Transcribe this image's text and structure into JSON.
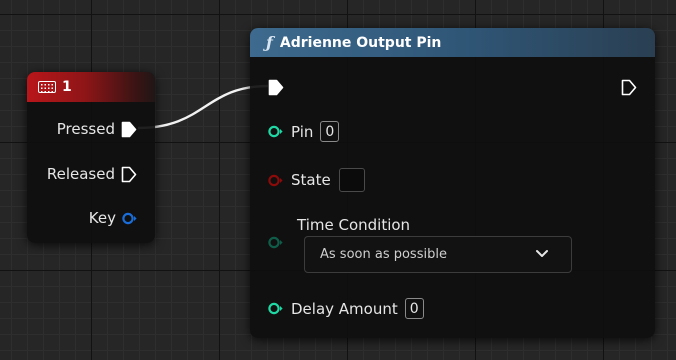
{
  "input_key_node": {
    "title": "1",
    "pins": {
      "pressed": "Pressed",
      "released": "Released",
      "key": "Key"
    }
  },
  "function_node": {
    "title": "Adrienne Output Pin",
    "pins": {
      "pin": {
        "label": "Pin",
        "value": "0"
      },
      "state": {
        "label": "State"
      },
      "time_condition": {
        "label": "Time Condition",
        "selected": "As soon as possible"
      },
      "delay_amount": {
        "label": "Delay Amount",
        "value": "0"
      }
    }
  },
  "colors": {
    "key_header": "#b8161a",
    "function_header": "#3d6a8e",
    "int_pin": "#1fd8a4",
    "bool_pin": "#8b0a0a",
    "struct_pin": "#1a6dd8",
    "enum_pin": "#0f5d49"
  }
}
